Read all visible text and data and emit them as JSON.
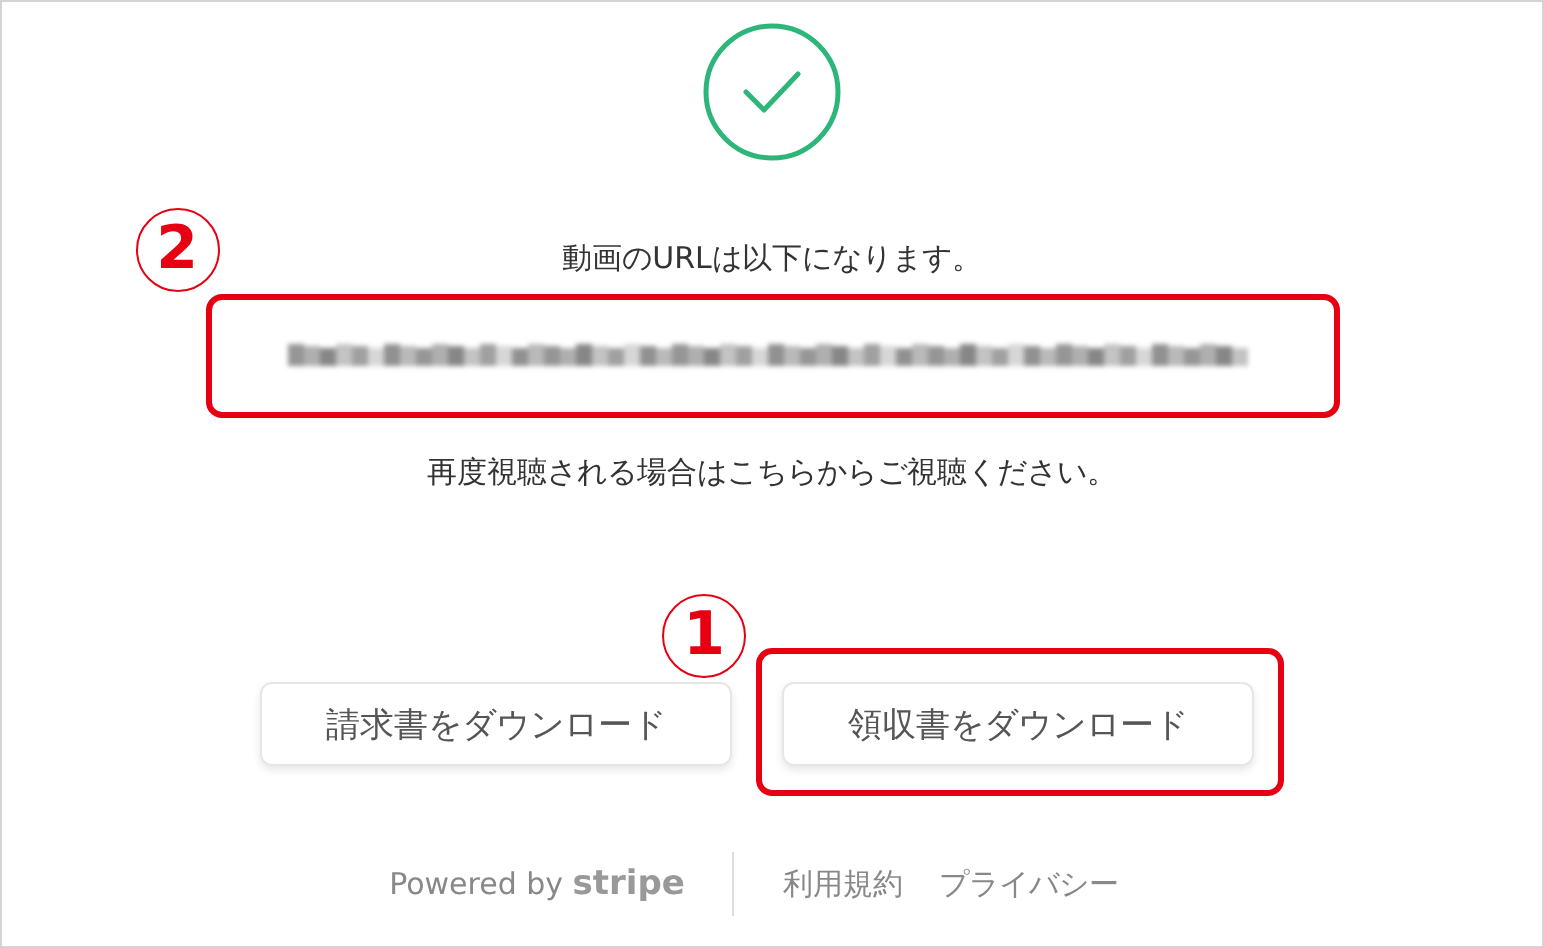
{
  "message": "動画のURLは以下になります。",
  "url_note": "再度視聴される場合はこちらからご視聴ください。",
  "buttons": [
    {
      "label": "請求書をダウンロード",
      "highlighted": false
    },
    {
      "label": "領収書をダウンロード",
      "highlighted": true,
      "marker": "1"
    }
  ],
  "url_marker": "2",
  "footer": {
    "powered_by": "Powered by **stripe**",
    "links": [
      "利用規約",
      "プライバシー"
    ]
  }
}
